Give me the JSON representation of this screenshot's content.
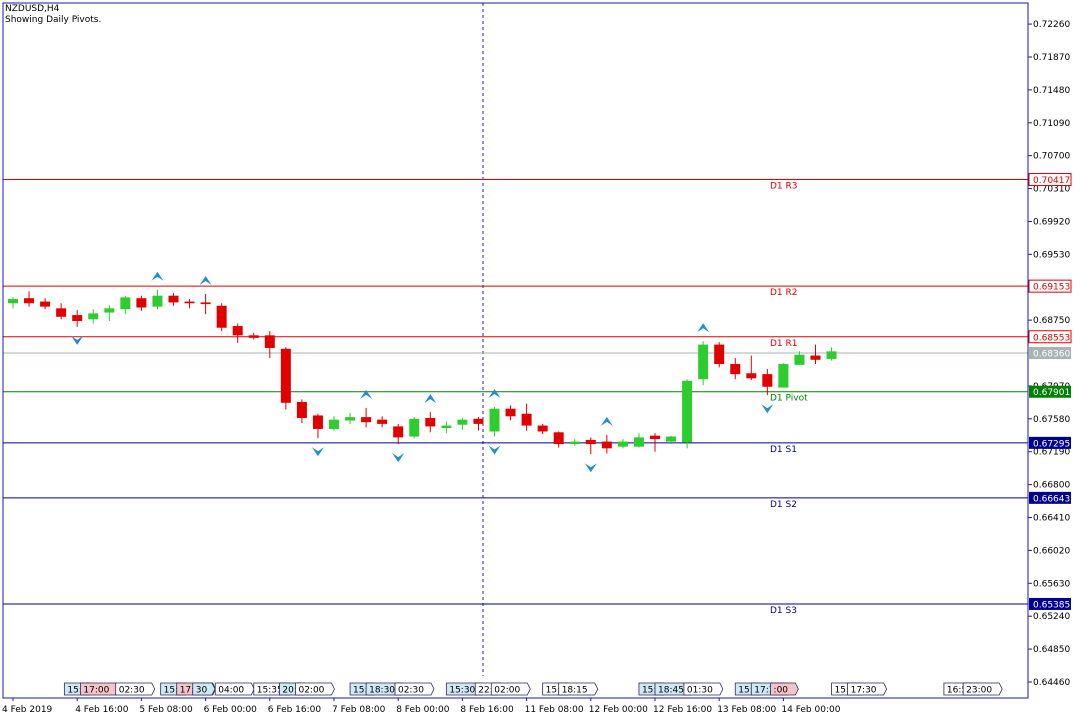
{
  "header": {
    "symbol": "NZDUSD,H4",
    "indicator": "Showing Daily Pivots."
  },
  "chart_data": {
    "type": "candlestick",
    "symbol": "NZDUSD",
    "timeframe": "H4",
    "ylim": [
      0.6427,
      0.7251
    ],
    "y_ticks": [
      "0.72260",
      "0.71870",
      "0.71480",
      "0.71090",
      "0.70700",
      "0.70310",
      "0.69920",
      "0.69530",
      "0.68750",
      "0.67970",
      "0.67580",
      "0.67190",
      "0.66800",
      "0.66410",
      "0.66020",
      "0.65630",
      "0.65240",
      "0.64850",
      "0.64460"
    ],
    "x_ticks": [
      {
        "i": 0,
        "label": "4 Feb 2019"
      },
      {
        "i": 4,
        "label": "4 Feb 16:00"
      },
      {
        "i": 8,
        "label": "5 Feb 08:00"
      },
      {
        "i": 12,
        "label": "6 Feb 00:00"
      },
      {
        "i": 16,
        "label": "6 Feb 16:00"
      },
      {
        "i": 20,
        "label": "7 Feb 08:00"
      },
      {
        "i": 24,
        "label": "8 Feb 00:00"
      },
      {
        "i": 28,
        "label": "8 Feb 16:00"
      },
      {
        "i": 32,
        "label": "11 Feb 08:00"
      },
      {
        "i": 36,
        "label": "12 Feb 00:00"
      },
      {
        "i": 40,
        "label": "12 Feb 16:00"
      },
      {
        "i": 44,
        "label": "13 Feb 08:00"
      },
      {
        "i": 48,
        "label": "14 Feb 00:00"
      }
    ],
    "pivots": [
      {
        "name": "D1 R3",
        "value": 0.70417,
        "label": "0.70417",
        "color": "#e00000"
      },
      {
        "name": "D1 R2",
        "value": 0.69153,
        "label": "0.69153",
        "color": "#e00000"
      },
      {
        "name": "D1 R1",
        "value": 0.68553,
        "label": "0.68553",
        "color": "#e00000"
      },
      {
        "name": "D1 Pivot",
        "value": 0.67901,
        "label": "0.67901",
        "color": "#008000"
      },
      {
        "name": "D1 S1",
        "value": 0.67295,
        "label": "0.67295",
        "color": "#000090"
      },
      {
        "name": "D1 S2",
        "value": 0.66643,
        "label": "0.66643",
        "color": "#000090"
      },
      {
        "name": "D1 S3",
        "value": 0.65385,
        "label": "0.65385",
        "color": "#000090"
      }
    ],
    "current_price": {
      "value": 0.6836,
      "label": "0.68360"
    },
    "candles": [
      {
        "o": 0.6895,
        "h": 0.6902,
        "l": 0.6889,
        "c": 0.69
      },
      {
        "o": 0.6901,
        "h": 0.6909,
        "l": 0.6891,
        "c": 0.6895
      },
      {
        "o": 0.6897,
        "h": 0.6901,
        "l": 0.6888,
        "c": 0.6891
      },
      {
        "o": 0.6889,
        "h": 0.6895,
        "l": 0.6876,
        "c": 0.6879
      },
      {
        "o": 0.6881,
        "h": 0.6887,
        "l": 0.6867,
        "c": 0.6874
      },
      {
        "o": 0.6876,
        "h": 0.6888,
        "l": 0.6871,
        "c": 0.6883
      },
      {
        "o": 0.6884,
        "h": 0.6893,
        "l": 0.6874,
        "c": 0.6889
      },
      {
        "o": 0.6888,
        "h": 0.6904,
        "l": 0.6882,
        "c": 0.6902
      },
      {
        "o": 0.6901,
        "h": 0.6904,
        "l": 0.6886,
        "c": 0.689
      },
      {
        "o": 0.6891,
        "h": 0.6911,
        "l": 0.6888,
        "c": 0.6904
      },
      {
        "o": 0.6904,
        "h": 0.6907,
        "l": 0.6892,
        "c": 0.6896
      },
      {
        "o": 0.6897,
        "h": 0.69,
        "l": 0.6889,
        "c": 0.6895
      },
      {
        "o": 0.6896,
        "h": 0.6906,
        "l": 0.6882,
        "c": 0.6894
      },
      {
        "o": 0.6892,
        "h": 0.6895,
        "l": 0.6862,
        "c": 0.6866
      },
      {
        "o": 0.6868,
        "h": 0.6871,
        "l": 0.6848,
        "c": 0.6857
      },
      {
        "o": 0.6857,
        "h": 0.686,
        "l": 0.6852,
        "c": 0.6854
      },
      {
        "o": 0.6857,
        "h": 0.6862,
        "l": 0.683,
        "c": 0.6842
      },
      {
        "o": 0.6841,
        "h": 0.6843,
        "l": 0.6769,
        "c": 0.6777
      },
      {
        "o": 0.6778,
        "h": 0.6781,
        "l": 0.6753,
        "c": 0.6759
      },
      {
        "o": 0.6762,
        "h": 0.6764,
        "l": 0.6735,
        "c": 0.6746
      },
      {
        "o": 0.6746,
        "h": 0.6761,
        "l": 0.6744,
        "c": 0.6757
      },
      {
        "o": 0.6756,
        "h": 0.6765,
        "l": 0.6752,
        "c": 0.676
      },
      {
        "o": 0.676,
        "h": 0.6771,
        "l": 0.6748,
        "c": 0.6754
      },
      {
        "o": 0.6757,
        "h": 0.6761,
        "l": 0.6748,
        "c": 0.6752
      },
      {
        "o": 0.6749,
        "h": 0.6752,
        "l": 0.6728,
        "c": 0.6736
      },
      {
        "o": 0.6737,
        "h": 0.676,
        "l": 0.6735,
        "c": 0.6758
      },
      {
        "o": 0.6759,
        "h": 0.6766,
        "l": 0.6742,
        "c": 0.6749
      },
      {
        "o": 0.6747,
        "h": 0.6755,
        "l": 0.6741,
        "c": 0.675
      },
      {
        "o": 0.6751,
        "h": 0.6759,
        "l": 0.6745,
        "c": 0.6757
      },
      {
        "o": 0.6758,
        "h": 0.676,
        "l": 0.6744,
        "c": 0.6752
      },
      {
        "o": 0.6743,
        "h": 0.6772,
        "l": 0.6737,
        "c": 0.677
      },
      {
        "o": 0.677,
        "h": 0.6774,
        "l": 0.6756,
        "c": 0.6761
      },
      {
        "o": 0.6764,
        "h": 0.6776,
        "l": 0.6744,
        "c": 0.675
      },
      {
        "o": 0.675,
        "h": 0.6752,
        "l": 0.674,
        "c": 0.6743
      },
      {
        "o": 0.6742,
        "h": 0.6743,
        "l": 0.6724,
        "c": 0.6728
      },
      {
        "o": 0.6728,
        "h": 0.6734,
        "l": 0.6726,
        "c": 0.6731
      },
      {
        "o": 0.6733,
        "h": 0.6736,
        "l": 0.6716,
        "c": 0.6728
      },
      {
        "o": 0.6731,
        "h": 0.6739,
        "l": 0.6717,
        "c": 0.6723
      },
      {
        "o": 0.6725,
        "h": 0.6734,
        "l": 0.6723,
        "c": 0.6731
      },
      {
        "o": 0.6725,
        "h": 0.6741,
        "l": 0.6724,
        "c": 0.6736
      },
      {
        "o": 0.6738,
        "h": 0.6741,
        "l": 0.6719,
        "c": 0.6734
      },
      {
        "o": 0.6731,
        "h": 0.6738,
        "l": 0.6728,
        "c": 0.6737
      },
      {
        "o": 0.673,
        "h": 0.6805,
        "l": 0.6723,
        "c": 0.6803
      },
      {
        "o": 0.6805,
        "h": 0.685,
        "l": 0.6798,
        "c": 0.6846
      },
      {
        "o": 0.6846,
        "h": 0.6849,
        "l": 0.6819,
        "c": 0.6823
      },
      {
        "o": 0.6823,
        "h": 0.683,
        "l": 0.6805,
        "c": 0.6811
      },
      {
        "o": 0.6812,
        "h": 0.6833,
        "l": 0.6804,
        "c": 0.6806
      },
      {
        "o": 0.6811,
        "h": 0.6817,
        "l": 0.6786,
        "c": 0.6796
      },
      {
        "o": 0.6795,
        "h": 0.6824,
        "l": 0.6795,
        "c": 0.6823
      },
      {
        "o": 0.6822,
        "h": 0.6838,
        "l": 0.6822,
        "c": 0.6834
      },
      {
        "o": 0.6833,
        "h": 0.6846,
        "l": 0.6823,
        "c": 0.6828
      },
      {
        "o": 0.6829,
        "h": 0.6843,
        "l": 0.6827,
        "c": 0.6838
      }
    ],
    "fractals_up": [
      9,
      12,
      22,
      26,
      30,
      37,
      43
    ],
    "fractals_down": [
      4,
      19,
      24,
      30,
      36,
      47
    ],
    "sessions": [
      {
        "i": 3.2,
        "label": "15:",
        "color": "#cfe9f3"
      },
      {
        "i": 4.2,
        "label": "17:00",
        "color": "#f4c4c8"
      },
      {
        "i": 6.4,
        "label": "02:30",
        "color": "#ffffff"
      },
      {
        "i": 9.2,
        "label": "15:",
        "color": "#cfe9f3"
      },
      {
        "i": 10.2,
        "label": "17:01",
        "color": "#f4c4c8"
      },
      {
        "i": 11.2,
        "label": "30",
        "color": "#cfe9f3"
      },
      {
        "i": 12.6,
        "label": "04:00",
        "color": "#ffffff"
      },
      {
        "i": 15.0,
        "label": "15:35",
        "color": "#ffffff"
      },
      {
        "i": 16.6,
        "label": "20:",
        "color": "#cfe9f3"
      },
      {
        "i": 17.6,
        "label": "02:00",
        "color": "#ffffff"
      },
      {
        "i": 21.0,
        "label": "15:",
        "color": "#cfe9f3"
      },
      {
        "i": 22.0,
        "label": "18:30",
        "color": "#cfe9f3"
      },
      {
        "i": 23.8,
        "label": "02:30",
        "color": "#ffffff"
      },
      {
        "i": 27.0,
        "label": "15:30",
        "color": "#cfe9f3"
      },
      {
        "i": 28.8,
        "label": "22:",
        "color": "#ffffff"
      },
      {
        "i": 29.8,
        "label": "02:00",
        "color": "#ffffff"
      },
      {
        "i": 33.0,
        "label": "15:",
        "color": "#ffffff"
      },
      {
        "i": 34.0,
        "label": "18:15",
        "color": "#ffffff"
      },
      {
        "i": 39.0,
        "label": "15:",
        "color": "#cfe9f3"
      },
      {
        "i": 40.0,
        "label": "18:45",
        "color": "#cfe9f3"
      },
      {
        "i": 41.8,
        "label": "01:30",
        "color": "#ffffff"
      },
      {
        "i": 45.0,
        "label": "15:",
        "color": "#cfe9f3"
      },
      {
        "i": 46.0,
        "label": "17:30",
        "color": "#cfe9f3"
      },
      {
        "i": 47.2,
        "label": ":00",
        "color": "#f4c4c8"
      },
      {
        "i": 51.0,
        "label": "15:3",
        "color": "#ffffff"
      },
      {
        "i": 52.0,
        "label": "17:30",
        "color": "#ffffff"
      },
      {
        "i": 58.0,
        "label": "16:55",
        "color": "#ffffff"
      },
      {
        "i": 59.2,
        "label": "23:00",
        "color": "#ffffff"
      }
    ],
    "colors": {
      "bull": "#2ecc2e",
      "bear": "#e00000",
      "axis": "#1a1aa0",
      "vline": "#2020c0",
      "fractal": "#1f8fd0"
    }
  }
}
